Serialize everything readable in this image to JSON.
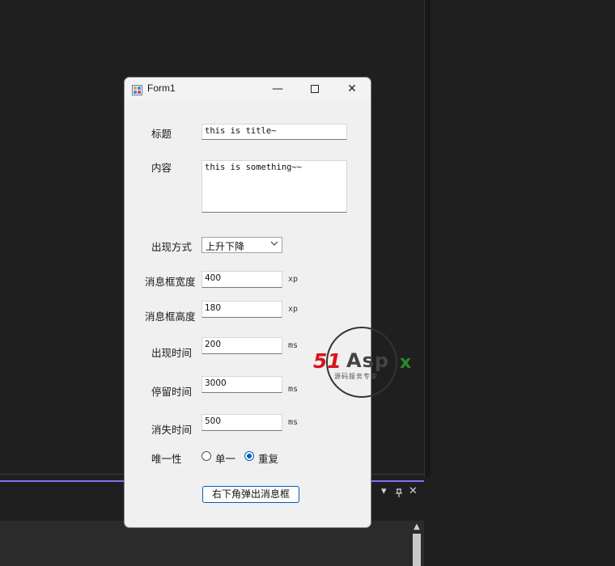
{
  "form": {
    "title": "Form1",
    "controls": {
      "minimize": "—",
      "maximize": "☐",
      "close": "✕"
    }
  },
  "fields": {
    "title_label": "标题",
    "title_value": "this is title~",
    "content_label": "内容",
    "content_value": "this is something~~",
    "appear_mode_label": "出现方式",
    "appear_mode_value": "上升下降",
    "width_label": "消息框宽度",
    "width_value": "400",
    "width_unit": "xp",
    "height_label": "消息框高度",
    "height_value": "180",
    "height_unit": "xp",
    "show_time_label": "出现时间",
    "show_time_value": "200",
    "show_time_unit": "ms",
    "stay_time_label": "停留时间",
    "stay_time_value": "3000",
    "stay_time_unit": "ms",
    "hide_time_label": "消失时间",
    "hide_time_value": "500",
    "hide_time_unit": "ms",
    "unique_label": "唯一性",
    "radio_single": "单一",
    "radio_repeat": "重复",
    "selected_radio": "重复"
  },
  "action_button": "右下角弹出消息框",
  "watermark": {
    "brand_number": "51",
    "brand_text": "Asp",
    "brand_x": "x",
    "subtitle": "源码服务专家"
  },
  "ide": {
    "pin_icon": "pin-icon",
    "close": "✕",
    "dropdown": "▾",
    "scroll_up": "▲"
  },
  "colors": {
    "accent": "#005fb8",
    "ide_background": "#1f1f1f",
    "ide_accent_line": "#8a6cf0",
    "watermark_red": "#d7141c",
    "watermark_green": "#2b8a2b"
  }
}
